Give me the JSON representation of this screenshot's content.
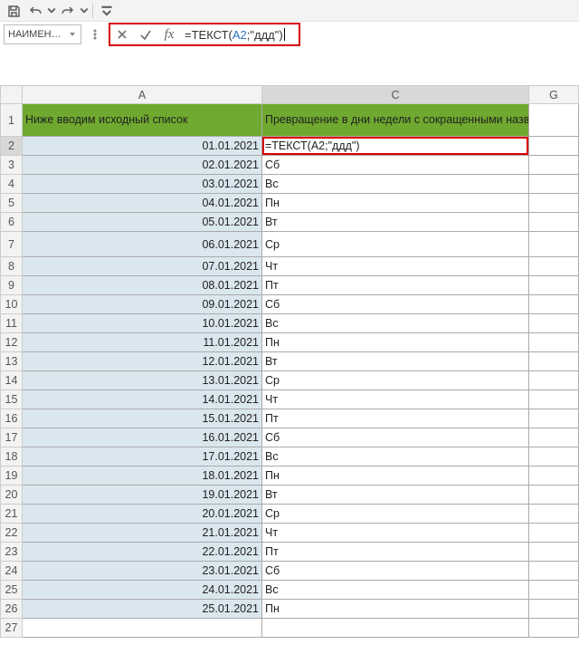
{
  "qat": {
    "save": "save-icon",
    "undo": "undo-icon",
    "redo": "redo-icon",
    "custom": "customize-icon"
  },
  "namebox": {
    "value": "НАИМЕН…"
  },
  "formula_bar": {
    "cancel": "×",
    "confirm": "✓",
    "fx": "fx",
    "text_before": "=ТЕКСТ(",
    "cell_ref": "A2",
    "text_after": ";\"ддд\")"
  },
  "column_headers": [
    "A",
    "C",
    "G"
  ],
  "row1": {
    "rownum": "1",
    "A": "Ниже вводим исходный список",
    "C": "Превращение в дни недели с сокращенными названиями через ТЕКСТ"
  },
  "active_cell": {
    "row": "2",
    "value": "=ТЕКСТ(A2;\"ддд\")"
  },
  "rows": [
    {
      "n": "2",
      "A": "01.01.2021",
      "C": "=ТЕКСТ(A2;\"ддд\")",
      "active": true
    },
    {
      "n": "3",
      "A": "02.01.2021",
      "C": "Сб"
    },
    {
      "n": "4",
      "A": "03.01.2021",
      "C": "Вс"
    },
    {
      "n": "5",
      "A": "04.01.2021",
      "C": "Пн"
    },
    {
      "n": "6",
      "A": "05.01.2021",
      "C": "Вт"
    },
    {
      "n": "7",
      "A": "06.01.2021",
      "C": "Ср",
      "tall": true
    },
    {
      "n": "8",
      "A": "07.01.2021",
      "C": "Чт"
    },
    {
      "n": "9",
      "A": "08.01.2021",
      "C": "Пт"
    },
    {
      "n": "10",
      "A": "09.01.2021",
      "C": "Сб"
    },
    {
      "n": "11",
      "A": "10.01.2021",
      "C": "Вс"
    },
    {
      "n": "12",
      "A": "11.01.2021",
      "C": "Пн"
    },
    {
      "n": "13",
      "A": "12.01.2021",
      "C": "Вт"
    },
    {
      "n": "14",
      "A": "13.01.2021",
      "C": "Ср"
    },
    {
      "n": "15",
      "A": "14.01.2021",
      "C": "Чт"
    },
    {
      "n": "16",
      "A": "15.01.2021",
      "C": "Пт"
    },
    {
      "n": "17",
      "A": "16.01.2021",
      "C": "Сб"
    },
    {
      "n": "18",
      "A": "17.01.2021",
      "C": "Вс"
    },
    {
      "n": "19",
      "A": "18.01.2021",
      "C": "Пн"
    },
    {
      "n": "20",
      "A": "19.01.2021",
      "C": "Вт"
    },
    {
      "n": "21",
      "A": "20.01.2021",
      "C": "Ср"
    },
    {
      "n": "22",
      "A": "21.01.2021",
      "C": "Чт"
    },
    {
      "n": "23",
      "A": "22.01.2021",
      "C": "Пт"
    },
    {
      "n": "24",
      "A": "23.01.2021",
      "C": "Сб"
    },
    {
      "n": "25",
      "A": "24.01.2021",
      "C": "Вс"
    },
    {
      "n": "26",
      "A": "25.01.2021",
      "C": "Пн"
    },
    {
      "n": "27",
      "A": "",
      "C": ""
    }
  ]
}
